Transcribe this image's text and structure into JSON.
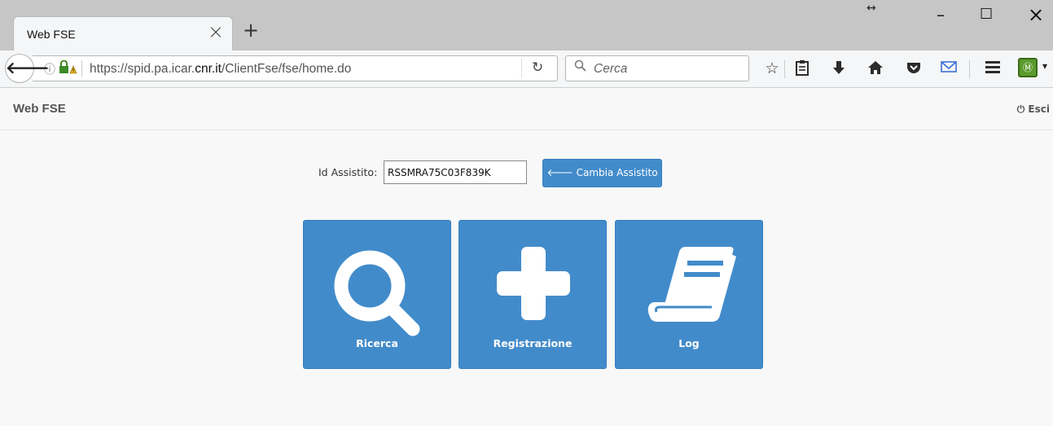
{
  "browser": {
    "tab_title": "Web FSE",
    "tab_close": "×",
    "new_tab": "+",
    "resize_indicator": "↔",
    "minimize": "–",
    "maximize": "☐",
    "close": "×",
    "url_prefix": "https://spid.pa.icar.",
    "url_domain": "cnr.it",
    "url_path": "/ClientFse/fse/home.do",
    "search_placeholder": "Cerca"
  },
  "app": {
    "brand": "Web FSE",
    "logout_label": "Esci",
    "id_label": "Id Assistito:",
    "id_value": "RSSMRA75C03F839K",
    "change_button": "Cambia Assistito",
    "tiles": [
      {
        "label": "Ricerca",
        "icon": "search-icon"
      },
      {
        "label": "Registrazione",
        "icon": "plus-icon"
      },
      {
        "label": "Log",
        "icon": "book-icon"
      }
    ]
  },
  "colors": {
    "primary": "#428bca",
    "tab_bar": "#c6c6c6",
    "page_bg": "#f8f8f8"
  }
}
